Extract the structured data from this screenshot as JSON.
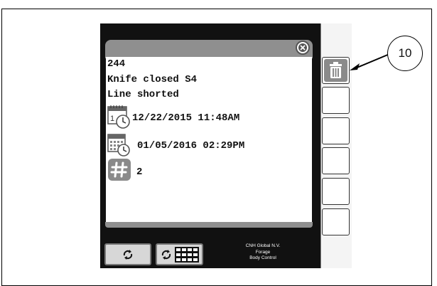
{
  "event": {
    "code": "244",
    "title": "Knife closed S4",
    "description": "Line shorted",
    "first_occurrence": "12/22/2015 11:48AM",
    "last_occurrence": "01/05/2016 02:29PM",
    "count": "2"
  },
  "footer": {
    "line1": "CNH Global N.V.",
    "line2": "Forage",
    "line3": "Body Control"
  },
  "callout": {
    "number": "10"
  },
  "icons": {
    "close": "close-icon",
    "first_date": "calendar-clock-first-icon",
    "last_date": "calendar-clock-last-icon",
    "count": "hash-icon",
    "delete": "trash-icon",
    "refresh": "recycle-icon",
    "grid": "grid-icon"
  },
  "colors": {
    "screen": "#111111",
    "panel_header": "#8f8f8f",
    "button_face": "#d7d7d7"
  }
}
